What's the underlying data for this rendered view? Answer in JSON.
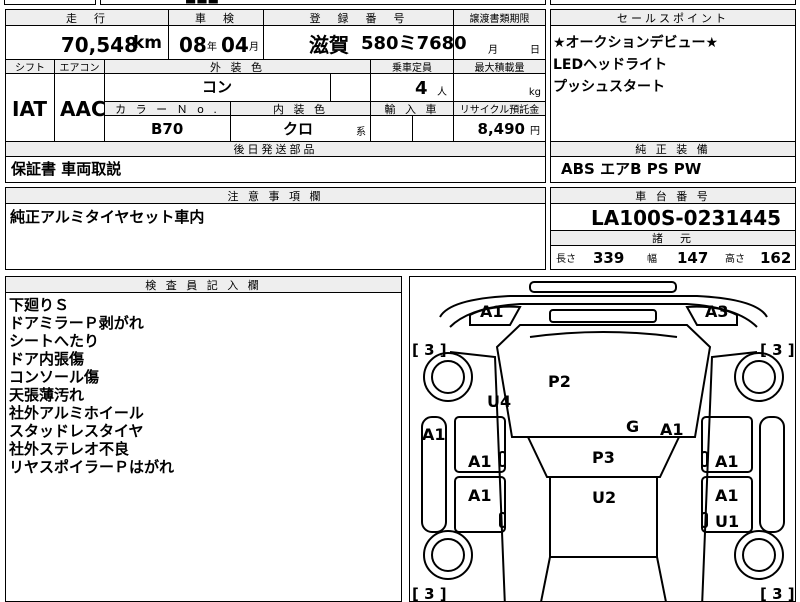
{
  "top_strip": {
    "partial_text": "■■■"
  },
  "main": {
    "headers": {
      "mileage": "走　行",
      "inspection": "車　検",
      "registration": "登　録　番　号",
      "transfer_deadline": "譲渡書類期限",
      "shift": "シフト",
      "aircon": "エアコン",
      "exterior_color": "外 装 色",
      "capacity": "乗車定員",
      "max_load": "最大積載量",
      "color_no": "カ ラ ー Ｎ o .",
      "interior_color": "内 装 色",
      "import": "輸 入 車",
      "recycle": "リサイクル預託金"
    },
    "mileage": {
      "value": "70,548",
      "unit": "km"
    },
    "inspection": {
      "year": "08",
      "year_unit": "年",
      "month": "04",
      "month_unit": "月"
    },
    "registration": {
      "region": "滋賀",
      "number": "580ミ7680"
    },
    "transfer_deadline": {
      "month_unit": "月",
      "day_unit": "日"
    },
    "shift": "IAT",
    "aircon": "AAC",
    "exterior_color": "コン",
    "capacity": {
      "value": "4",
      "unit": "人"
    },
    "max_load": {
      "unit": "kg"
    },
    "color_no": "B70",
    "interior_color": {
      "value": "クロ",
      "suffix": "系"
    },
    "recycle": {
      "value": "8,490",
      "unit": "円"
    }
  },
  "sales_points": {
    "header": "セールスポイント",
    "lines": [
      "★オークションデビュー★",
      "LEDヘッドライト",
      "プッシュスタート"
    ]
  },
  "later_parts": {
    "header": "後日発送部品",
    "value": "保証書 車両取説"
  },
  "standard_equipment": {
    "header": "純 正 装 備",
    "value": "ABS エアB PS PW"
  },
  "caution": {
    "header": "注 意 事 項 欄",
    "value": "純正アルミタイヤセット車内"
  },
  "chassis": {
    "header": "車 台 番 号",
    "value": "LA100S-0231445"
  },
  "specs": {
    "header": "諸　元",
    "length_label": "長さ",
    "length": "339",
    "width_label": "幅",
    "width": "147",
    "height_label": "高さ",
    "height": "162"
  },
  "inspector": {
    "header": "検 査 員 記 入 欄",
    "lines": [
      "下廻りＳ",
      "ドアミラーＰ剥がれ",
      "シートへたり",
      "ドア内張傷",
      "コンソール傷",
      "天張薄汚れ",
      "社外アルミホイール",
      "スタッドレスタイヤ",
      "社外ステレオ不良",
      "リヤスポイラーＰはがれ"
    ]
  },
  "diagram": {
    "marks": [
      {
        "key": "a1_front_left",
        "text": "A1"
      },
      {
        "key": "a3_front_right",
        "text": "A3"
      },
      {
        "key": "p2_hood",
        "text": "P2"
      },
      {
        "key": "u4_fender_left",
        "text": "U4"
      },
      {
        "key": "a1_side_left",
        "text": "A1"
      },
      {
        "key": "g_windshield",
        "text": "G"
      },
      {
        "key": "a1_windshield_right",
        "text": "A1"
      },
      {
        "key": "a1_door_left_front",
        "text": "A1"
      },
      {
        "key": "p3_roof",
        "text": "P3"
      },
      {
        "key": "a1_door_right_front",
        "text": "A1"
      },
      {
        "key": "a1_door_left_rear",
        "text": "A1"
      },
      {
        "key": "u2_roof_rear",
        "text": "U2"
      },
      {
        "key": "a1_door_right_rear",
        "text": "A1"
      },
      {
        "key": "u1_door_right_rear",
        "text": "U1"
      }
    ],
    "tire_brackets": [
      "[ 3 ]",
      "[ 3 ]",
      "[ 3 ]",
      "[ 3 ]"
    ]
  }
}
